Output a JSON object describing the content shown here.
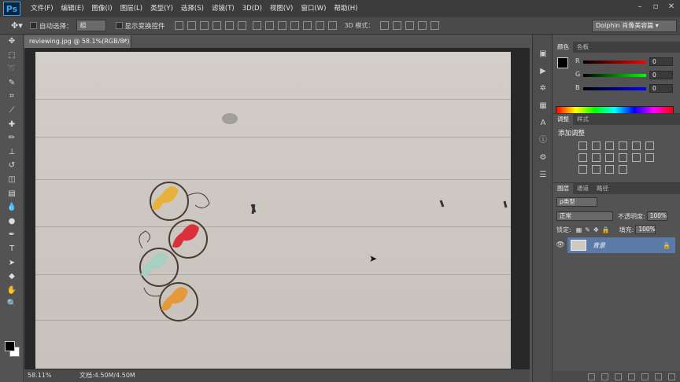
{
  "app": {
    "logo": "Ps",
    "menus": [
      "文件(F)",
      "编辑(E)",
      "图像(I)",
      "图层(L)",
      "类型(Y)",
      "选择(S)",
      "滤镜(T)",
      "3D(D)",
      "视图(V)",
      "窗口(W)",
      "帮助(H)"
    ]
  },
  "options_bar": {
    "auto_select_label": "自动选择：",
    "auto_select_value": "组",
    "show_transform_label": "显示变换控件",
    "mode_3d_label": "3D 模式：",
    "workspace": "Dolphin 肖像美容篇"
  },
  "document": {
    "tab_title": "reviewing.jpg @ 58.1%(RGB/8*)",
    "zoom": "58.11%",
    "doc_size": "文档:4.50M/4.50M"
  },
  "color_panel": {
    "tabs": [
      "颜色",
      "色板"
    ],
    "r_label": "R",
    "r_value": "0",
    "g_label": "G",
    "g_value": "0",
    "b_label": "B",
    "b_value": "0"
  },
  "adjustments_panel": {
    "tabs": [
      "调整",
      "样式"
    ],
    "title": "添加调整"
  },
  "layers_panel": {
    "tabs": [
      "图层",
      "通道",
      "路径"
    ],
    "filter": "ρ类型",
    "blend_mode": "正常",
    "opacity_label": "不透明度:",
    "opacity_value": "100%",
    "lock_label": "锁定:",
    "fill_label": "填充:",
    "fill_value": "100%",
    "layer_name": "背景"
  },
  "colors": {
    "accent_layer": "#5b7aa7",
    "ps_blue": "#31a8ff"
  }
}
